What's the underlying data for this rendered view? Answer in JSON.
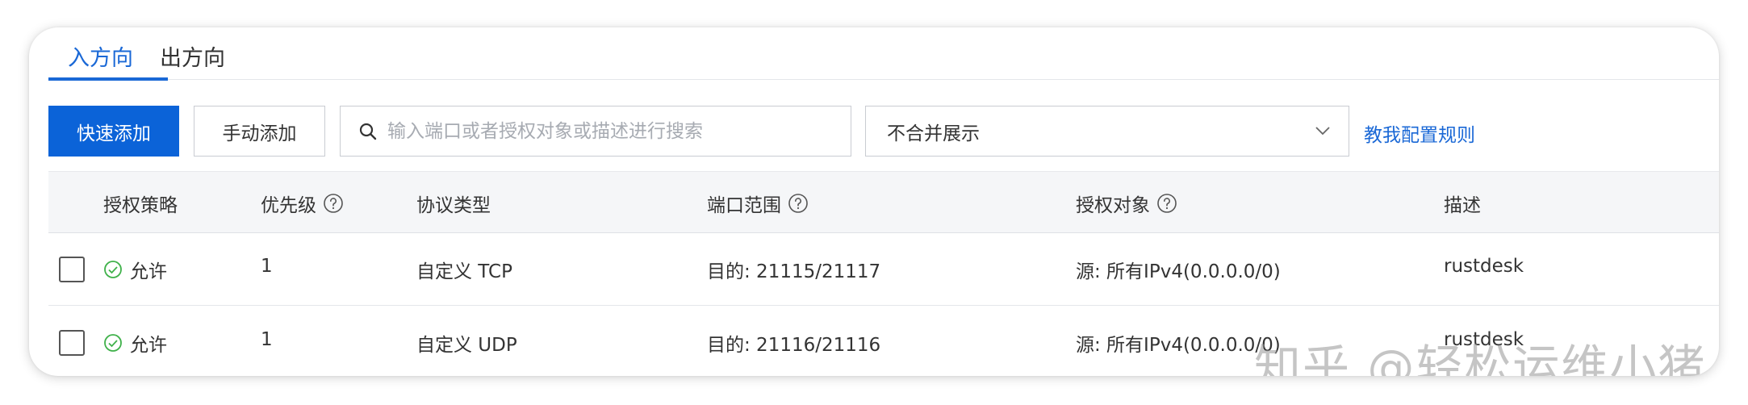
{
  "tabs": [
    {
      "label": "入方向",
      "active": true
    },
    {
      "label": "出方向",
      "active": false
    }
  ],
  "toolbar": {
    "quick_add": "快速添加",
    "manual_add": "手动添加",
    "search_placeholder": "输入端口或者授权对象或描述进行搜索",
    "merge_select_value": "不合并展示",
    "help_link": "教我配置规则"
  },
  "table": {
    "headers": {
      "policy": "授权策略",
      "priority": "优先级",
      "protocol": "协议类型",
      "port_range": "端口范围",
      "auth_object": "授权对象",
      "description": "描述"
    },
    "rows": [
      {
        "policy": "允许",
        "priority": "1",
        "protocol": "自定义 TCP",
        "port_range": "目的: 21115/21117",
        "auth_object": "源: 所有IPv4(0.0.0.0/0)",
        "description": "rustdesk"
      },
      {
        "policy": "允许",
        "priority": "1",
        "protocol": "自定义 UDP",
        "port_range": "目的: 21116/21116",
        "auth_object": "源: 所有IPv4(0.0.0.0/0)",
        "description": "rustdesk"
      }
    ]
  },
  "watermark": "知乎 @轻松运维小猪",
  "colors": {
    "accent": "#1a68d6",
    "primary_button": "#0b63d8",
    "allow_green": "#3fb14a",
    "header_bg": "#f5f6f8"
  },
  "icons": {
    "search": "search-icon",
    "chevron": "chevron-down-icon",
    "help": "question-circle-icon",
    "allow": "check-circle-icon"
  }
}
